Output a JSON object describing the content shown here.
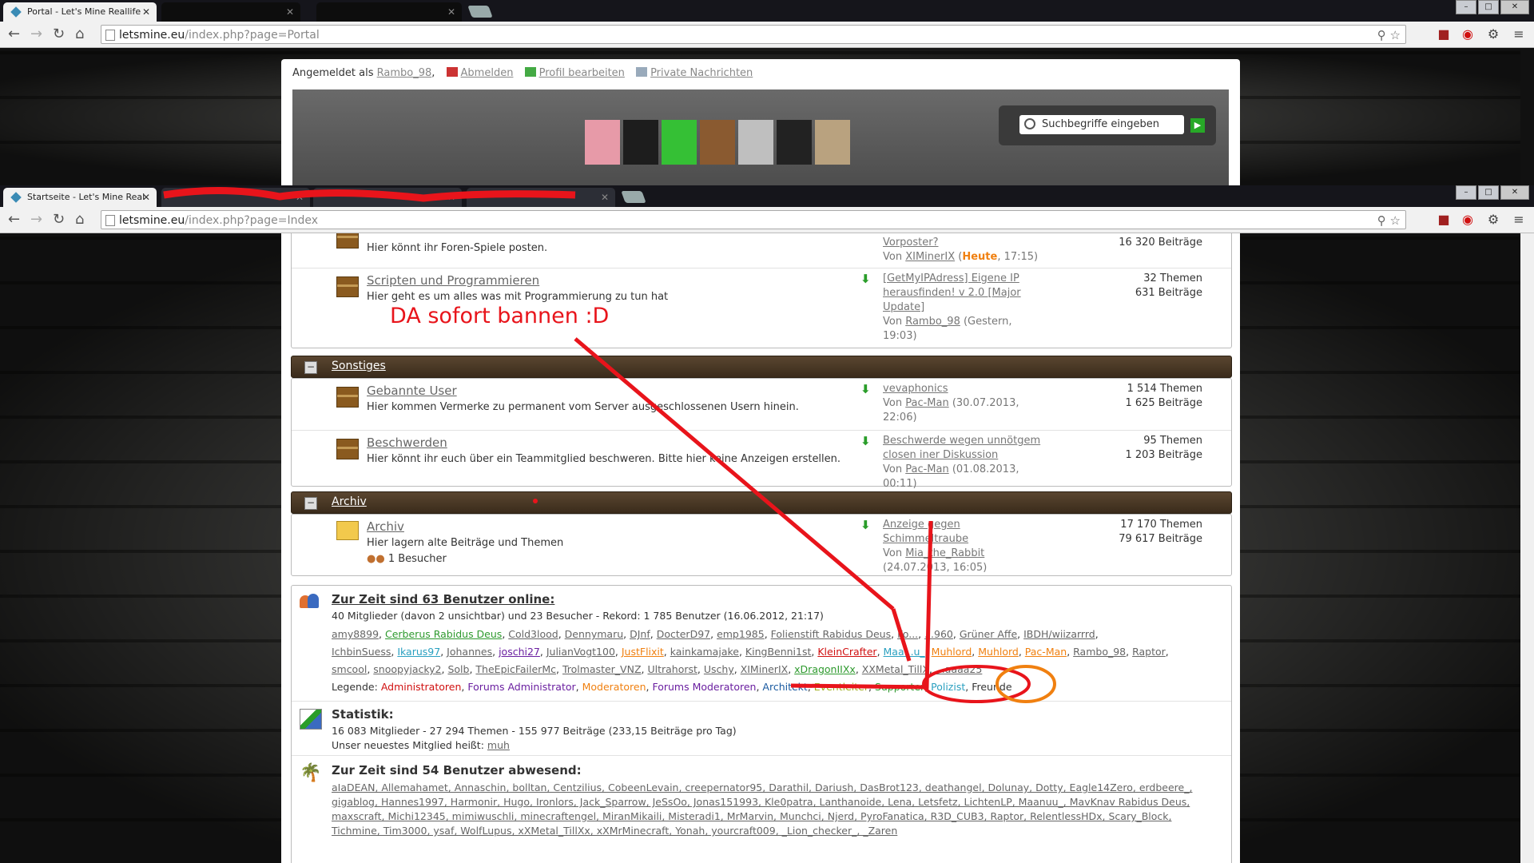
{
  "top_window": {
    "tabs": [
      {
        "title": "Portal - Let's Mine Reallife"
      },
      {
        "title": ""
      },
      {
        "title": ""
      }
    ],
    "url_host": "letsmine.eu",
    "url_path": "/index.php?page=Portal",
    "userbar": {
      "logged_in_prefix": "Angemeldet als",
      "username": "Rambo_98",
      "logout": "Abmelden",
      "edit_profile": "Profil bearbeiten",
      "messages": "Private Nachrichten"
    },
    "search_placeholder": "Suchbegriffe eingeben"
  },
  "bottom_window": {
    "tabs": [
      {
        "title": "Startseite - Let's Mine Real"
      },
      {
        "title": ""
      },
      {
        "title": ""
      },
      {
        "title": ""
      }
    ],
    "url_host": "letsmine.eu",
    "url_path": "/index.php?page=Index"
  },
  "forum": {
    "partial_row": {
      "desc": "Hier könnt ihr Foren-Spiele posten.",
      "last_title": "Vorposter?",
      "last_by": "Von",
      "last_user": "XIMinerIX",
      "last_when_highlight": "Heute",
      "last_when_rest": ", 17:15)",
      "stats2": "16 320 Beiträge"
    },
    "script_row": {
      "title": "Scripten und Programmieren",
      "desc": "Hier geht es um alles was mit Programmierung zu tun hat",
      "last_line1": "[GetMyIPAdress] Eigene IP",
      "last_line2": "herausfinden! v 2.0 [Major",
      "last_line3": "Update]",
      "last_user": "Rambo_98",
      "last_when": "(Gestern,",
      "last_when2": "19:03)",
      "stats1": "32 Themen",
      "stats2": "631 Beiträge"
    },
    "cat_sonstiges": "Sonstiges",
    "banned_row": {
      "title": "Gebannte User",
      "desc": "Hier kommen Vermerke zu permanent vom Server ausgeschlossenen Usern hinein.",
      "last_line1": "vevaphonics",
      "last_user": "Pac-Man",
      "last_when": "(30.07.2013,",
      "last_when2": "22:06)",
      "stats1": "1 514 Themen",
      "stats2": "1 625 Beiträge"
    },
    "complaints_row": {
      "title": "Beschwerden",
      "desc": "Hier könnt ihr euch über ein Teammitglied beschweren. Bitte hier keine Anzeigen erstellen.",
      "last_line1": "Beschwerde wegen unnötgem",
      "last_line2": "closen iner Diskussion",
      "last_user": "Pac-Man",
      "last_when": "(01.08.2013,",
      "last_when2": "00:11)",
      "stats1": "95 Themen",
      "stats2": "1 203 Beiträge"
    },
    "cat_archiv": "Archiv",
    "archive_row": {
      "title": "Archiv",
      "desc": "Hier lagern alte Beiträge und Themen",
      "visitors": "1 Besucher",
      "last_line1": "Anzeige gegen",
      "last_line2": "Schimmeltraube",
      "last_user": "Mia_the_Rabbit",
      "last_when": "(24.07.2013, 16:05)",
      "stats1": "17 170 Themen",
      "stats2": "79 617 Beiträge"
    },
    "von": "Von"
  },
  "online": {
    "title": "Zur Zeit sind 63 Benutzer online:",
    "summary": "40 Mitglieder (davon 2 unsichtbar) und 23 Besucher - Rekord: 1 785 Benutzer (16.06.2012, 21:17)",
    "users_line1": [
      {
        "n": "amy8899",
        "c": "#666"
      },
      {
        "n": "Cerberus Rabidus Deus",
        "c": "#2e9a2e"
      },
      {
        "n": "Cold3lood",
        "c": "#666"
      },
      {
        "n": "Dennymaru",
        "c": "#666"
      },
      {
        "n": "DJnf",
        "c": "#666"
      },
      {
        "n": "DocterD97",
        "c": "#666"
      },
      {
        "n": "emp1985",
        "c": "#666"
      },
      {
        "n": "Folienstift Rabidus Deus",
        "c": "#666"
      },
      {
        "n": "Fo...",
        "c": "#666"
      },
      {
        "n": "...960",
        "c": "#666"
      },
      {
        "n": "Grüner Affe",
        "c": "#666"
      },
      {
        "n": "IBDH/wiizarrrd",
        "c": "#666"
      }
    ],
    "users_line2": [
      {
        "n": "IchbinSuess",
        "c": "#666"
      },
      {
        "n": "Ikarus97",
        "c": "#2aa0c0"
      },
      {
        "n": "Johannes",
        "c": "#666"
      },
      {
        "n": "joschi27",
        "c": "#6a1fa0"
      },
      {
        "n": "JulianVogt100",
        "c": "#666"
      },
      {
        "n": "JustFlixit",
        "c": "#f08010"
      },
      {
        "n": "kainkamajake",
        "c": "#666"
      },
      {
        "n": "KingBenni1st",
        "c": "#666"
      },
      {
        "n": "KleinCrafter",
        "c": "#d01010"
      },
      {
        "n": "Maa...u_",
        "c": "#2aa0c0"
      },
      {
        "n": "Muhlord",
        "c": "#f08010"
      },
      {
        "n": "Muhlord",
        "c": "#f08010"
      },
      {
        "n": "Pac-Man",
        "c": "#f08010"
      },
      {
        "n": "Rambo_98",
        "c": "#666"
      },
      {
        "n": "Raptor",
        "c": "#666"
      }
    ],
    "users_line3": [
      {
        "n": "smcool",
        "c": "#666"
      },
      {
        "n": "snoopyjacky2",
        "c": "#666"
      },
      {
        "n": "Solb",
        "c": "#666"
      },
      {
        "n": "TheEpicFailerMc",
        "c": "#666"
      },
      {
        "n": "Trolmaster_VNZ",
        "c": "#666"
      },
      {
        "n": "Ultrahorst",
        "c": "#666"
      },
      {
        "n": "Uschy",
        "c": "#666"
      },
      {
        "n": "XIMinerIX",
        "c": "#666"
      },
      {
        "n": "xDragonIIXx",
        "c": "#2e9a2e"
      },
      {
        "n": "XXMetal_TillX",
        "c": "#666"
      },
      {
        "n": "...aaaa25",
        "c": "#666"
      }
    ],
    "legend_label": "Legende:",
    "legend": [
      {
        "n": "Administratoren",
        "c": "#d01010"
      },
      {
        "n": "Forums Administrator",
        "c": "#6a1fa0"
      },
      {
        "n": "Moderatoren",
        "c": "#f08010"
      },
      {
        "n": "Forums Moderatoren",
        "c": "#6a1fa0"
      },
      {
        "n": "Architekt",
        "c": "#1a5aa0"
      },
      {
        "n": "Eventleiter",
        "c": "#a0b020"
      },
      {
        "n": "Supporter",
        "c": "#2e9a2e"
      },
      {
        "n": "Polizist",
        "c": "#2aa0c0"
      },
      {
        "n": "Freunde",
        "c": "#333"
      }
    ]
  },
  "stats": {
    "title": "Statistik:",
    "line1": "16 083 Mitglieder - 27 294 Themen - 155 977 Beiträge (233,15 Beiträge pro Tag)",
    "line2_prefix": "Unser neuestes Mitglied heißt:",
    "newest": "muh"
  },
  "absent": {
    "title": "Zur Zeit sind 54 Benutzer abwesend:",
    "line1": "aIaDEAN, Allemahamet, Annaschin, bolltan, Centzilius, CobeenLevain, creepernator95, Darathil, Dariush, DasBrot123, deathangel, Dolunay, Dotty, Eagle14Zero, erdbeere_,",
    "line2": "gigablog, Hannes1997, Harmonir, Hugo, Ironlors, Jack_Sparrow, JeSsOo, Jonas151993, Kle0patra, Lanthanoide, Lena, Letsfetz, LichtenLP, Maanuu_, MavKnav Rabidus Deus,",
    "line3": "maxscraft, Michi12345, mimiwuschli, minecraftengel, MiranMikaili, Misteradi1, MrMarvin, Munchci, Njerd, PyroFanatica, R3D_CUB3, Raptor, RelentlessHDx, Scary_Block,",
    "line4": "Tichmine, Tim3000, ysaf, WolfLupus, xXMetal_TillXx, xXMrMinecraft, Yonah, yourcraft009, _Lion_checker_, _Zaren"
  },
  "annotation": "DA sofort bannen :D",
  "colors": {
    "annotation_red": "#e8141b",
    "category_brown": "#4a3826",
    "highlight_orange": "#f08010"
  }
}
